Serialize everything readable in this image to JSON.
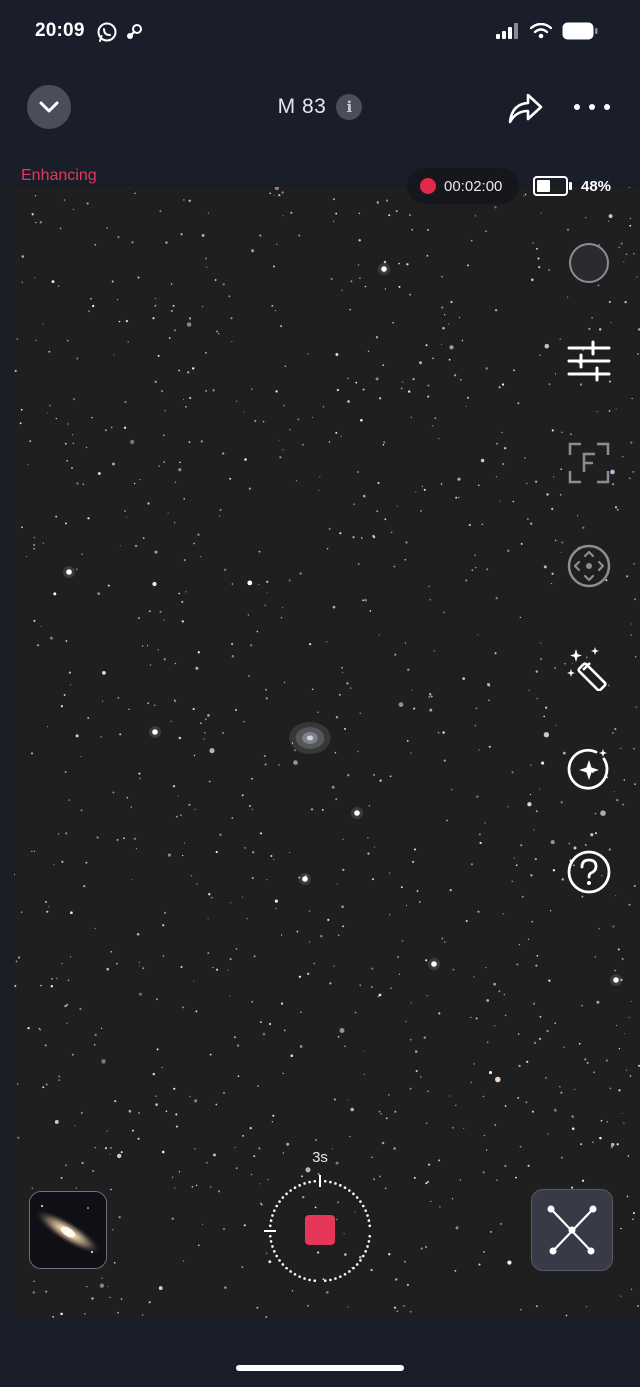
{
  "status_bar": {
    "time": "20:09",
    "app_icons": [
      "whatsapp-icon",
      "steam-icon"
    ],
    "signal_icon": "cellular-signal-icon",
    "wifi_icon": "wifi-icon",
    "battery_icon": "battery-icon"
  },
  "header": {
    "collapse_icon": "chevron-down-icon",
    "title": "M 83",
    "info_icon": "info-icon",
    "share_icon": "share-arrow-icon",
    "more_icon": "more-horizontal-icon"
  },
  "session": {
    "enhancing_label": "Enhancing",
    "recording_time": "00:02:00",
    "recording_color": "#e3284a",
    "device_battery_percent": "48%",
    "device_battery_level": 0.48
  },
  "side_tools": [
    {
      "name": "exposure-dial-icon"
    },
    {
      "name": "sliders-adjust-icon"
    },
    {
      "name": "focus-frame-icon"
    },
    {
      "name": "direction-pad-icon"
    },
    {
      "name": "magic-wand-icon"
    },
    {
      "name": "sparkle-enhance-icon"
    },
    {
      "name": "help-icon"
    }
  ],
  "capture": {
    "interval_label": "3s",
    "stop_color": "#e5375a",
    "thumbnail": "galaxy-thumbnail",
    "constellation_icon": "constellation-icon"
  },
  "colors": {
    "accent": "#e3385a",
    "background": "#1a1d2a",
    "sky": "#201f1f"
  }
}
